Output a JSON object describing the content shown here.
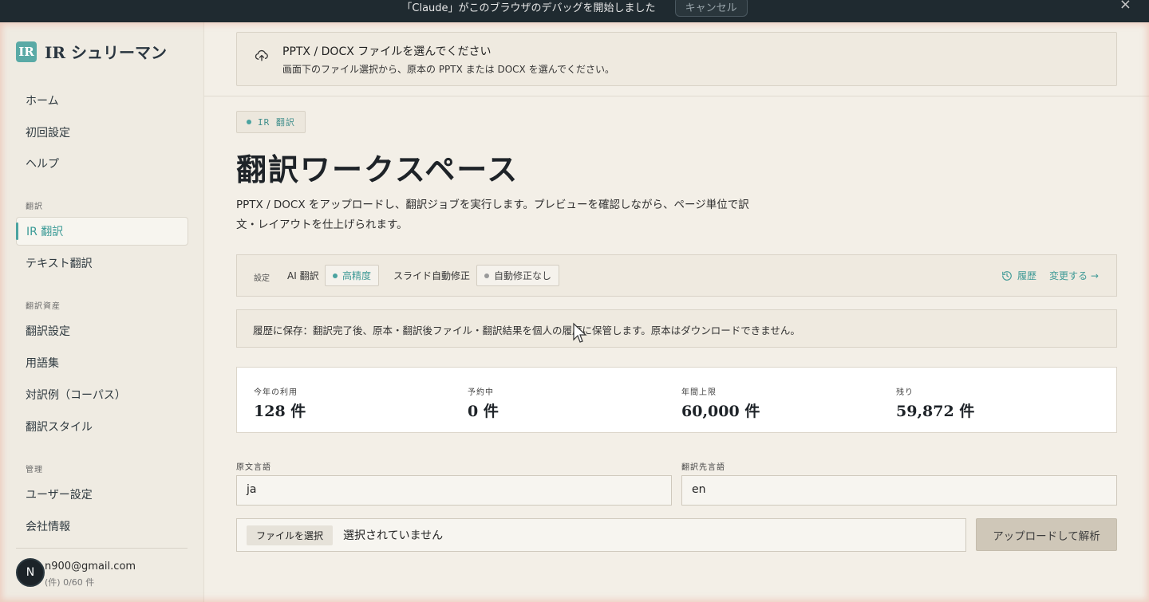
{
  "notification": {
    "message": "「Claude」がこのブラウザのデバッグを開始しました",
    "cancel_label": "キャンセル",
    "close_icon": "×"
  },
  "brand": {
    "logo_text": "IR",
    "name": "IR シュリーマン"
  },
  "sidebar": {
    "top_items": [
      {
        "label": "ホーム"
      },
      {
        "label": "初回設定"
      },
      {
        "label": "ヘルプ"
      }
    ],
    "sections": [
      {
        "title": "翻訳",
        "items": [
          {
            "label": "IR 翻訳",
            "active": true
          },
          {
            "label": "テキスト翻訳"
          }
        ]
      },
      {
        "title": "翻訳資産",
        "items": [
          {
            "label": "翻訳設定"
          },
          {
            "label": "用語集"
          },
          {
            "label": "対訳例（コーパス）"
          },
          {
            "label": "翻訳スタイル"
          }
        ]
      },
      {
        "title": "管理",
        "items": [
          {
            "label": "ユーザー設定"
          },
          {
            "label": "会社情報"
          }
        ]
      }
    ],
    "user": {
      "avatar_letter": "N",
      "email": "n900@gmail.com",
      "sub": "(件) 0/60 件"
    }
  },
  "banner": {
    "icon": "upload-cloud-icon",
    "title": "PPTX / DOCX ファイルを選んでください",
    "subtitle": "画面下のファイル選択から、原本の PPTX または DOCX を選んでください。"
  },
  "tag": {
    "label": "IR 翻訳"
  },
  "page": {
    "title": "翻訳ワークスペース",
    "description": "PPTX / DOCX をアップロードし、翻訳ジョブを実行します。プレビューを確認しながら、ページ単位で訳文・レイアウトを仕上げられます。"
  },
  "settings": {
    "label": "設定",
    "ai_label": "AI 翻訳",
    "ai_value": "高精度",
    "slide_label": "スライド自動修正",
    "slide_value": "自動修正なし",
    "history_label": "履歴",
    "change_label": "変更する →"
  },
  "notice": {
    "text": "履歴に保存：翻訳完了後、原本・翻訳後ファイル・翻訳結果を個人の履歴に保管します。原本はダウンロードできません。"
  },
  "stats": [
    {
      "label": "今年の利用",
      "value": "128 件"
    },
    {
      "label": "予約中",
      "value": "0 件"
    },
    {
      "label": "年間上限",
      "value": "60,000 件"
    },
    {
      "label": "残り",
      "value": "59,872 件"
    }
  ],
  "languages": {
    "source_label": "原文言語",
    "source_value": "ja",
    "target_label": "翻訳先言語",
    "target_value": "en"
  },
  "file": {
    "choose_label": "ファイルを選択",
    "status": "選択されていません",
    "upload_label": "アップロードして解析"
  },
  "colors": {
    "accent": "#4aa3a0",
    "background": "#f3efe7",
    "sidebar": "#efebe2",
    "topbar": "#1f2a30"
  }
}
